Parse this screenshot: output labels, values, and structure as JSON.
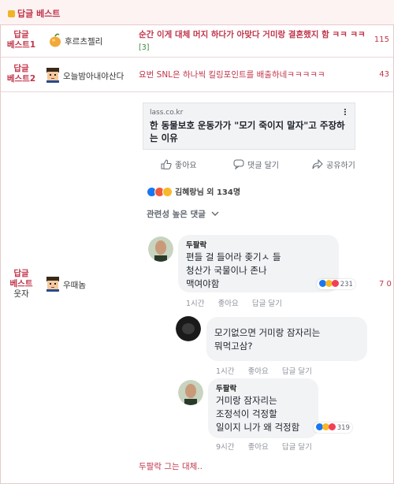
{
  "header": {
    "title": "답글 베스트"
  },
  "rows": [
    {
      "rank": [
        "답글",
        "베스트1"
      ],
      "nickname": "후르츠젤리",
      "title": "순간 이게 대체 머지 하다가 아맞다 거미랑 결혼했지 함 ㅋㅋ ㅋㅋ",
      "comments": "[3]",
      "count": "115"
    },
    {
      "rank": [
        "답글",
        "베스트2"
      ],
      "nickname": "오늘밤아내야산다",
      "title": "요번 SNL은 하나씩 킬링포인트를 배출하네ㅋㅋㅋㅋㅋ",
      "count": "43"
    },
    {
      "rank": [
        "답글",
        "베스트",
        "웃자"
      ],
      "nickname": "우때놈",
      "count": "7  0"
    }
  ],
  "facebook": {
    "link_domain": "lass.co.kr",
    "link_headline": "한 동물보호 운동가가 \"모기 죽이지 말자\"고 주장하는 이유",
    "actions": {
      "like": "좋아요",
      "comment": "댓글 달기",
      "share": "공유하기"
    },
    "reactions_text": "김혜랑님 외 134명",
    "sort_label": "관련성 높은 댓글",
    "comments": [
      {
        "author": "두팔락",
        "lines": [
          "편들 걸 들어라 좆기ㅅ  들",
          "청산가   국물이나 존나",
          "맥여야함"
        ],
        "meta": [
          "1시간",
          "좋아요",
          "답글 달기"
        ],
        "reaction_count": "231"
      },
      {
        "author": "",
        "lines": [
          "모기없으면 거미랑 잠자리는",
          "뭐먹고삼?"
        ],
        "meta": [
          "1시간",
          "좋아요",
          "답글 달기"
        ]
      },
      {
        "author": "두팔락",
        "lines": [
          "거미랑 잠자리는",
          "조정석이 걱정할",
          "일이지 니가 왜 걱정함"
        ],
        "meta": [
          "9시간",
          "좋아요",
          "답글 달기"
        ],
        "reaction_count": "319"
      }
    ]
  },
  "caption": "두팔락 그는 대체..",
  "colors": {
    "accent": "#c0354a",
    "fb_blue": "#1877f2",
    "bubble": "#f2f3f5"
  }
}
